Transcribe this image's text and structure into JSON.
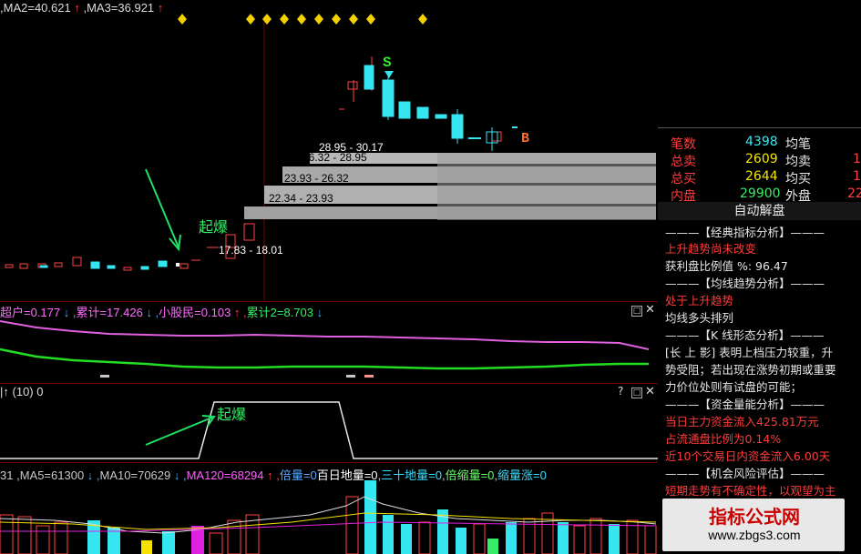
{
  "main": {
    "ma2_label": "MA2=40.621",
    "ma3_label": "MA3=36.921",
    "signal_s": "S",
    "signal_b": "B",
    "qibao_label": "起爆",
    "chip_ranges": [
      "28.95 - 30.17",
      "26.32 - 28.95",
      "23.93 - 26.32",
      "22.34 - 23.93",
      "17.83 - 18.01"
    ]
  },
  "pane2": {
    "header": [
      "超户=0.177",
      "累计=17.426",
      "小股民=0.103",
      "累计2=8.703"
    ],
    "colors": {
      "header": "#ff6bff",
      "pink_line": "#e060e0",
      "green_line": "#22dd22"
    }
  },
  "pane3": {
    "header_a": "(10)",
    "header_b": "0",
    "qibao_label": "起爆"
  },
  "pane4": {
    "header": [
      {
        "text": "31",
        "color": "#c8c8c8"
      },
      {
        "text": "MA5=61300",
        "color": "#c8c8c8"
      },
      {
        "text": "MA10=70629",
        "color": "#c8c8c8"
      },
      {
        "text": "MA120=68294",
        "color": "#ff60ff"
      },
      {
        "text": "倍量=0",
        "color": "#55aaff"
      },
      {
        "text": "百日地量=0",
        "color": "#ffffff"
      },
      {
        "text": "三十地量=0",
        "color": "#33ddff"
      },
      {
        "text": "倍缩量=0",
        "color": "#66ff66"
      },
      {
        "text": "缩量涨=0",
        "color": "#33ddff"
      }
    ]
  },
  "quote": {
    "rows": [
      {
        "l1": "笔数",
        "v1": "4398",
        "l2": "均笔",
        "v2": ""
      },
      {
        "l1": "总卖",
        "v1": "2609",
        "l2": "均卖",
        "v2": "1"
      },
      {
        "l1": "总买",
        "v1": "2644",
        "l2": "均买",
        "v2": "1"
      },
      {
        "l1": "内盘",
        "v1": "29900",
        "l2": "外盘",
        "v2": "22"
      }
    ],
    "auto_title": "自动解盘"
  },
  "analysis": {
    "h1": "———【经典指标分析】———",
    "l1": "上升趋势尚未改变",
    "l2": "获利盘比例值 %: 96.47",
    "h2": "———【均线趋势分析】———",
    "l3": "处于上升趋势",
    "l4": "均线多头排列",
    "h3": "———【K 线形态分析】———",
    "l5": "[长 上 影] 表明上档压力较重，升",
    "l6": "势受阻；若出现在涨势初期或重要",
    "l7": "力价位处则有试盘的可能；",
    "h4": "———【资金量能分析】———",
    "l8": "当日主力资金流入425.81万元",
    "l9": "占流通盘比例为0.14%",
    "l10": "近10个交易日内资金流入6.00天",
    "h5": "———【机会风险评估】———",
    "l11": "短期走势有不确定性，以观望为主"
  },
  "watermark": {
    "title": "指标公式网",
    "url": "www.zbgs3.com"
  }
}
